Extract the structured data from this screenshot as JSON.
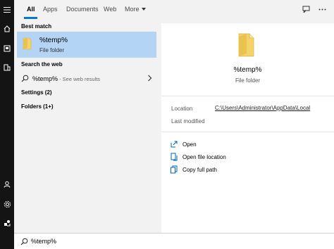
{
  "tabs": [
    {
      "label": "All",
      "active": true
    },
    {
      "label": "Apps"
    },
    {
      "label": "Documents"
    },
    {
      "label": "Web"
    },
    {
      "label": "More"
    }
  ],
  "rail_icons": [
    "menu-icon",
    "home-icon",
    "document-icon",
    "building-icon",
    "user-icon",
    "gear-icon",
    "user-switch-icon"
  ],
  "toolbar_icons": [
    "feedback-icon",
    "more-options-icon"
  ],
  "results": {
    "best_match_header": "Best match",
    "best_match": {
      "title": "%temp%",
      "subtitle": "File folder"
    },
    "search_web_header": "Search the web",
    "web_item": {
      "query": "%temp%",
      "hint": " - See web results"
    },
    "settings": "Settings (2)",
    "folders": "Folders (1+)"
  },
  "preview": {
    "title": "%temp%",
    "subtitle": "File folder",
    "location_label": "Location",
    "location_value": "C:\\Users\\Administrator\\AppData\\Local",
    "last_modified_label": "Last modified",
    "actions": [
      {
        "label": "Open",
        "icon": "open-icon"
      },
      {
        "label": "Open file location",
        "icon": "file-location-icon"
      },
      {
        "label": "Copy full path",
        "icon": "copy-icon"
      }
    ]
  },
  "search": {
    "value": "%temp%"
  },
  "colors": {
    "accent": "#0078d7",
    "highlight": "#b3d4f5",
    "rail": "#141414",
    "folder": "#f5d36a"
  }
}
